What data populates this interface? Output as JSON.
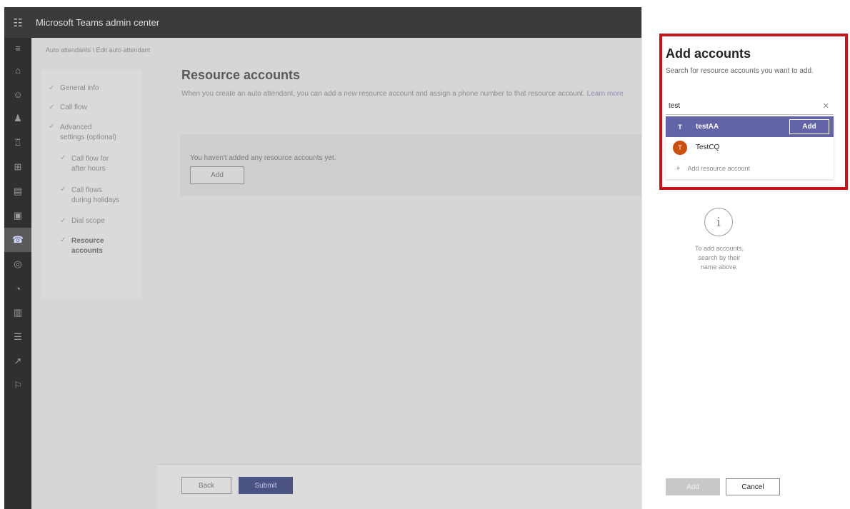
{
  "app": {
    "title": "Microsoft Teams admin center",
    "waffle_icon": "waffle-icon"
  },
  "rail": {
    "icons": [
      "hamburger-icon",
      "home-icon",
      "teams-icon",
      "users-icon",
      "devices-icon",
      "locations-icon",
      "meetings-icon",
      "messaging-icon",
      "voice-icon",
      "policy-packages-icon",
      "analytics-icon",
      "org-settings-icon",
      "planning-icon",
      "notifications-icon",
      "call-quality-icon"
    ],
    "active_index": 8
  },
  "breadcrumb": "Auto attendants \\ Edit auto attendant",
  "steps": [
    {
      "label": "General info",
      "sub": false
    },
    {
      "label": "Call flow",
      "sub": false
    },
    {
      "label": "Advanced settings (optional)",
      "sub": false
    },
    {
      "label": "Call flow for after hours",
      "sub": true
    },
    {
      "label": "Call flows during holidays",
      "sub": true
    },
    {
      "label": "Dial scope",
      "sub": true
    },
    {
      "label": "Resource accounts",
      "sub": true,
      "bold": true
    }
  ],
  "main": {
    "title": "Resource accounts",
    "description": "When you create an auto attendant, you can add a new resource account and assign a phone number to that resource account.",
    "learn_more": "Learn more",
    "empty_text": "You haven't added any resource accounts yet.",
    "add_label": "Add"
  },
  "footer": {
    "back_label": "Back",
    "submit_label": "Submit"
  },
  "panel": {
    "title": "Add accounts",
    "subtitle": "Search for resource accounts you want to add.",
    "search_value": "test",
    "results": [
      {
        "initial": "T",
        "name": "testAA",
        "selected": true,
        "add_label": "Add"
      },
      {
        "initial": "T",
        "name": "TestCQ",
        "selected": false
      }
    ],
    "add_resource_label": "Add resource account",
    "info_text": "To add accounts, search by their name above.",
    "add_button": "Add",
    "cancel_button": "Cancel",
    "accent_color": "#6264a7",
    "highlight_color": "#c4151c"
  }
}
